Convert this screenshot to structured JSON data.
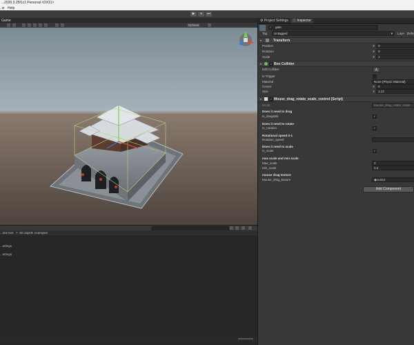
{
  "window": {
    "title": "...2020.3.25f1c1 Personal <DX11>"
  },
  "menu": {
    "items": [
      "..w",
      "Help"
    ]
  },
  "toolbar": {
    "play_icon": "▶",
    "pause_icon": "⏸",
    "step_icon": "⏭"
  },
  "scene": {
    "tab_label": "Game",
    "shading_mode": "Gizmos"
  },
  "project": {
    "breadcrumb": [
      "...ime test",
      "3D object",
      "examples"
    ],
    "items": [
      "...ettings",
      "...ettings"
    ]
  },
  "inspector": {
    "tabs": [
      "Project Settings",
      "Inspector"
    ],
    "object": {
      "name": "gate",
      "tag_label": "Tag",
      "tag_value": "Untagged",
      "layer_label": "Laye",
      "layer_value": "Defa"
    },
    "transform": {
      "title": "Transform",
      "rows": [
        {
          "label": "Position",
          "axis": "X",
          "value": "0"
        },
        {
          "label": "Rotation",
          "axis": "X",
          "value": "0"
        },
        {
          "label": "Scale",
          "axis": "X",
          "value": "1"
        }
      ]
    },
    "box_collider": {
      "title": "Box Collider",
      "edit_collider": "Edit Collider",
      "is_trigger": "Is Trigger",
      "material_label": "Material",
      "material_value": "None (Physic Material)",
      "center_label": "Center",
      "center_axis": "X",
      "center_value": "0",
      "size_label": "Size",
      "size_axis": "X",
      "size_value": "1.13"
    },
    "script": {
      "title": "Mouse_drag_rotate_scale_control (Script)",
      "script_label": "Script",
      "script_value": "Mouse_drag_rotate_scale...",
      "drag_header": "Does it need to drag",
      "drag_label": "Is_dragable",
      "rotate_header": "Does it need to rotate",
      "rotate_label": "Is_rotation",
      "speed_header": "Rotational speed 0-1",
      "speed_label": "Rotation_speed",
      "scale_header": "Does it need to scale",
      "scale_label": "Is_scale",
      "minmax_header": "max scale and min scale",
      "max_label": "Max_scale",
      "max_value": "3",
      "min_label": "Min_scale",
      "min_value": "0.2",
      "texture_header": "mouse drag texture",
      "texture_label": "Mouse_drag_texture",
      "texture_value": "◉cursor"
    },
    "add_component": "Add Component"
  },
  "icons": [
    "play-icon",
    "pause-icon",
    "step-icon",
    "gear-icon",
    "lock-icon",
    "help-icon",
    "checkbox-icon",
    "gizmo-axis-icon",
    "gate-model"
  ]
}
